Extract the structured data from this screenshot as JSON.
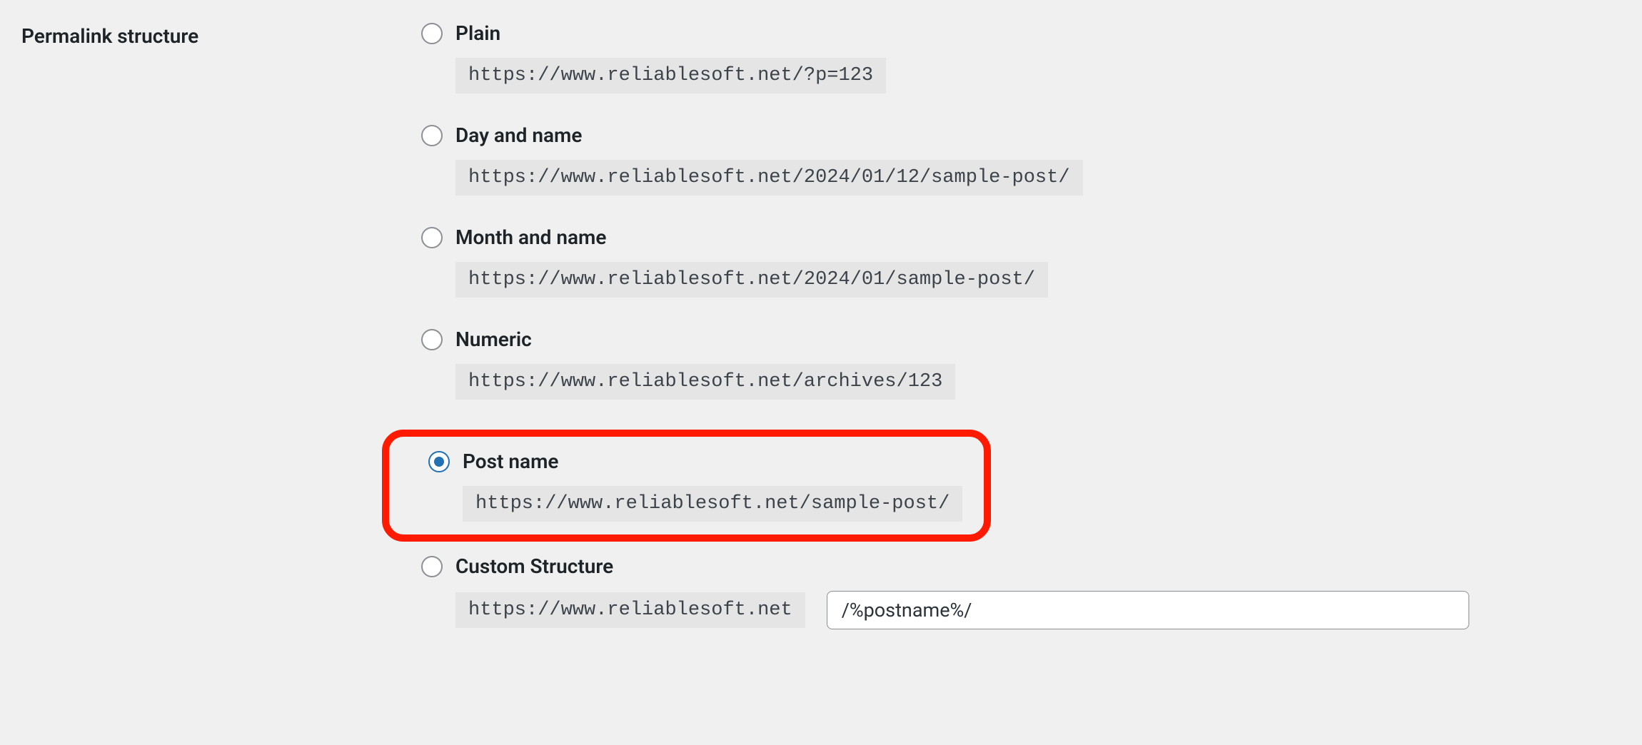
{
  "section_label": "Permalink structure",
  "options": {
    "plain": {
      "label": "Plain",
      "example": "https://www.reliablesoft.net/?p=123"
    },
    "day_name": {
      "label": "Day and name",
      "example": "https://www.reliablesoft.net/2024/01/12/sample-post/"
    },
    "month_name": {
      "label": "Month and name",
      "example": "https://www.reliablesoft.net/2024/01/sample-post/"
    },
    "numeric": {
      "label": "Numeric",
      "example": "https://www.reliablesoft.net/archives/123"
    },
    "post_name": {
      "label": "Post name",
      "example": "https://www.reliablesoft.net/sample-post/"
    },
    "custom": {
      "label": "Custom Structure",
      "prefix": "https://www.reliablesoft.net",
      "value": "/%postname%/"
    }
  },
  "selected": "post_name"
}
